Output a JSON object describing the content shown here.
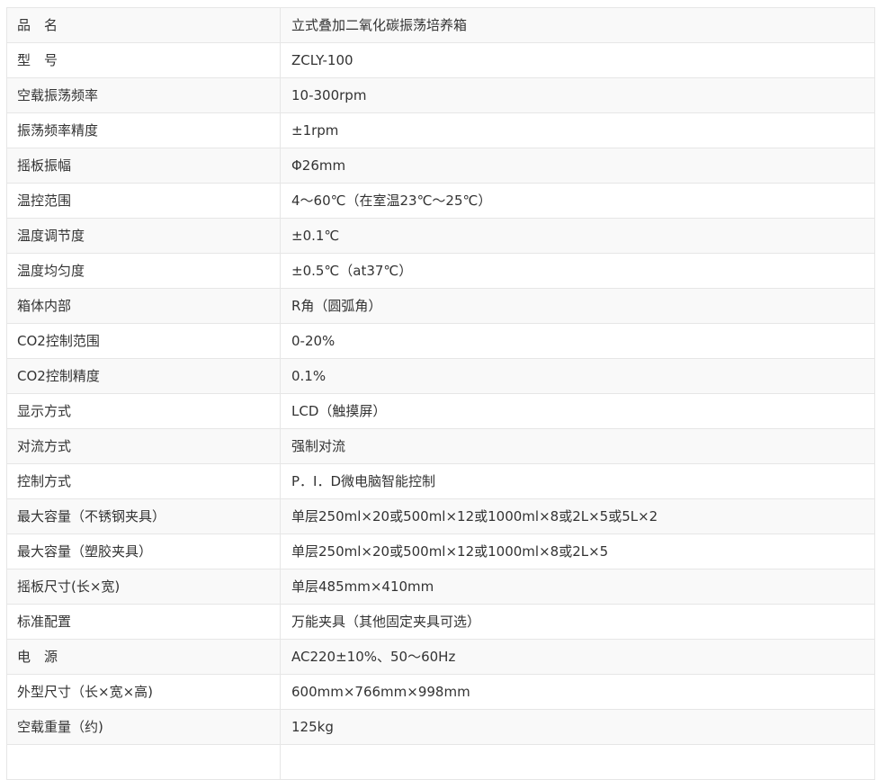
{
  "spec_table": {
    "rows": [
      {
        "key": "品　名",
        "value": "立式叠加二氧化碳振荡培养箱"
      },
      {
        "key": "型　号",
        "value": "ZCLY-100"
      },
      {
        "key": "空载振荡频率",
        "value": "10-300rpm"
      },
      {
        "key": "振荡频率精度",
        "value": "±1rpm"
      },
      {
        "key": "摇板振幅",
        "value": "Φ26mm"
      },
      {
        "key": "温控范围",
        "value": "4～60℃（在室温23℃～25℃）"
      },
      {
        "key": "温度调节度",
        "value": "±0.1℃"
      },
      {
        "key": "温度均匀度",
        "value": "±0.5℃（at37℃）"
      },
      {
        "key": "箱体内部",
        "value": "R角（圆弧角）"
      },
      {
        "key": "CO2控制范围",
        "value": "0-20%"
      },
      {
        "key": "CO2控制精度",
        "value": "0.1%"
      },
      {
        "key": "显示方式",
        "value": "LCD（触摸屏）"
      },
      {
        "key": "对流方式",
        "value": "强制对流"
      },
      {
        "key": "控制方式",
        "value": "P．I．D微电脑智能控制"
      },
      {
        "key": "最大容量（不锈钢夹具）",
        "value": "单层250ml×20或500ml×12或1000ml×8或2L×5或5L×2"
      },
      {
        "key": "最大容量（塑胶夹具）",
        "value": "单层250ml×20或500ml×12或1000ml×8或2L×5"
      },
      {
        "key": "摇板尺寸(长×宽)",
        "value": "单层485mm×410mm"
      },
      {
        "key": "标准配置",
        "value": "万能夹具（其他固定夹具可选）"
      },
      {
        "key": "电　源",
        "value": "AC220±10%、50～60Hz"
      },
      {
        "key": "外型尺寸（长×宽×高)",
        "value": "600mm×766mm×998mm"
      },
      {
        "key": "空载重量（约)",
        "value": "125kg"
      },
      {
        "key": "",
        "value": ""
      }
    ]
  }
}
